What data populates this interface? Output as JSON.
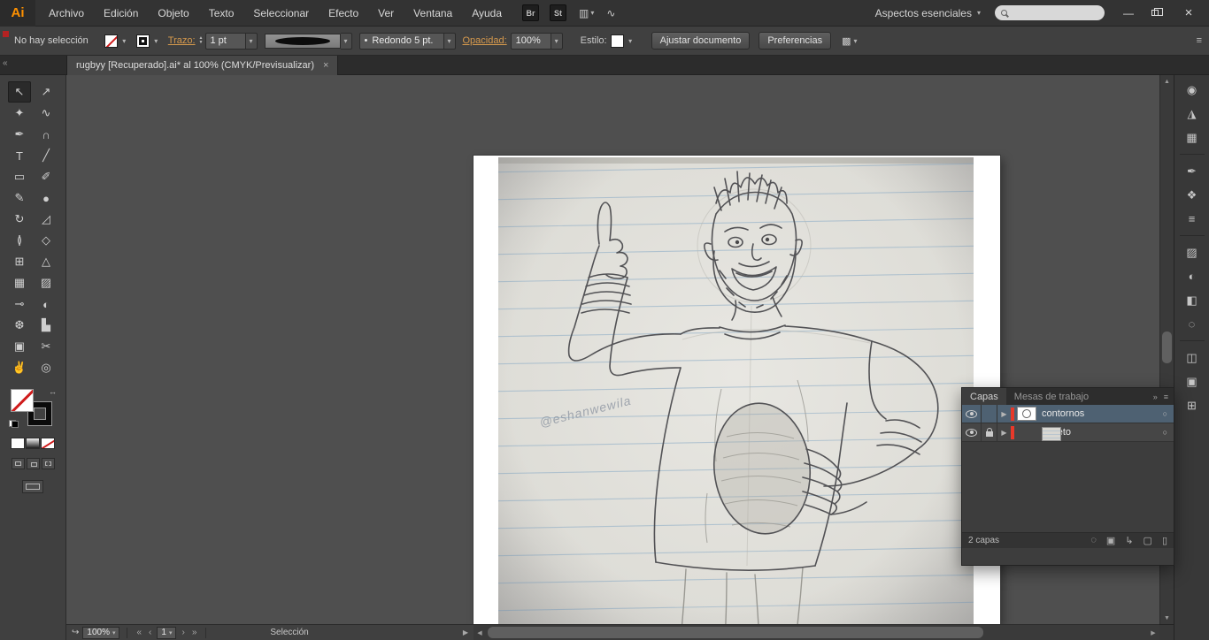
{
  "app": {
    "logo_text": "Ai"
  },
  "colors": {
    "logo_orange": "#ff9100",
    "link_amber": "#d79a4d",
    "none_red": "#cf1b1b",
    "layer_strip_red": "#e8392a",
    "selected_row_blue": "#4e6172"
  },
  "menubar": {
    "items": [
      "Archivo",
      "Edición",
      "Objeto",
      "Texto",
      "Seleccionar",
      "Efecto",
      "Ver",
      "Ventana",
      "Ayuda"
    ],
    "bridge_label": "Br",
    "stock_label": "St",
    "workspace_label": "Aspectos esenciales",
    "search_value": ""
  },
  "window_controls": {
    "minimize_glyph": "—",
    "close_glyph": "×"
  },
  "control_bar": {
    "selection_status": "No hay selección",
    "stroke_label": "Trazo:",
    "stroke_value": "1 pt",
    "brush_bullet": "•",
    "brush_value": "Redondo 5 pt.",
    "opacity_label": "Opacidad:",
    "opacity_value": "100%",
    "style_label": "Estilo:",
    "fit_document_label": "Ajustar documento",
    "preferences_label": "Preferencias"
  },
  "tab_bar": {
    "document_title": "rugbyy [Recuperado].ai* al 100% (CMYK/Previsualizar)",
    "close_glyph": "×"
  },
  "tools": [
    {
      "name": "selection",
      "glyph": "↖"
    },
    {
      "name": "direct-selection",
      "glyph": "↗"
    },
    {
      "name": "magic-wand",
      "glyph": "✦"
    },
    {
      "name": "lasso",
      "glyph": "∿"
    },
    {
      "name": "pen",
      "glyph": "✒"
    },
    {
      "name": "curvature",
      "glyph": "∩"
    },
    {
      "name": "type",
      "glyph": "T"
    },
    {
      "name": "line-segment",
      "glyph": "╱"
    },
    {
      "name": "rectangle",
      "glyph": "▭"
    },
    {
      "name": "paintbrush",
      "glyph": "✐"
    },
    {
      "name": "pencil",
      "glyph": "✎"
    },
    {
      "name": "blob-brush",
      "glyph": "●"
    },
    {
      "name": "rotate",
      "glyph": "↻"
    },
    {
      "name": "scale",
      "glyph": "◿"
    },
    {
      "name": "width",
      "glyph": "≬"
    },
    {
      "name": "free-transform",
      "glyph": "◇"
    },
    {
      "name": "shape-builder",
      "glyph": "⊞"
    },
    {
      "name": "perspective-grid",
      "glyph": "△"
    },
    {
      "name": "mesh",
      "glyph": "▦"
    },
    {
      "name": "gradient",
      "glyph": "▨"
    },
    {
      "name": "eyedropper",
      "glyph": "⊸"
    },
    {
      "name": "blend",
      "glyph": "◐"
    },
    {
      "name": "symbol-sprayer",
      "glyph": "❆"
    },
    {
      "name": "column-graph",
      "glyph": "▙"
    },
    {
      "name": "artboard",
      "glyph": "▣"
    },
    {
      "name": "slice",
      "glyph": "✂"
    },
    {
      "name": "hand",
      "glyph": "✌"
    },
    {
      "name": "zoom",
      "glyph": "◎"
    }
  ],
  "dock_icons": [
    {
      "name": "color",
      "glyph": "◉"
    },
    {
      "name": "color-guide",
      "glyph": "◮"
    },
    {
      "name": "swatches",
      "glyph": "▦"
    },
    {
      "name": "brushes",
      "glyph": "✒"
    },
    {
      "name": "symbols",
      "glyph": "❖"
    },
    {
      "name": "stroke",
      "glyph": "≡"
    },
    {
      "name": "gradient",
      "glyph": "▨"
    },
    {
      "name": "transparency",
      "glyph": "◐"
    },
    {
      "name": "appearance",
      "glyph": "◧"
    },
    {
      "name": "graphic-styles",
      "glyph": "◌"
    },
    {
      "name": "layers",
      "glyph": "◫"
    },
    {
      "name": "artboards",
      "glyph": "▣"
    },
    {
      "name": "asset-export",
      "glyph": "⊞"
    }
  ],
  "layers_panel": {
    "tab_capas": "Capas",
    "tab_mesas": "Mesas de trabajo",
    "layers": [
      {
        "name": "contornos"
      },
      {
        "name": "boceto"
      }
    ],
    "footer_count": "2 capas"
  },
  "status_bar": {
    "zoom_value": "100%",
    "artboard_value": "1",
    "tool_label": "Selección"
  },
  "artwork": {
    "signature": "@eshanwewila"
  },
  "icons": {
    "dropdown": "▾",
    "collapse_left": "«",
    "collapse_right": "»",
    "panel_menu": "≡",
    "menu_arrange": "▥",
    "menu_share": "∿",
    "select_similar": "▩",
    "swap": "↔",
    "scroll_up": "▲",
    "scroll_down": "▼",
    "scroll_left": "◀",
    "scroll_right": "▶",
    "disclosure": "▶",
    "target": "○",
    "nav_first": "«",
    "nav_prev": "‹",
    "nav_next": "›",
    "nav_last": "»",
    "status_launch": "↪",
    "expand_panel": "▶",
    "layers_footer": {
      "locate": "◌",
      "mask": "▣",
      "sublayer": "↳",
      "new_layer": "▢",
      "delete": "▯"
    }
  }
}
